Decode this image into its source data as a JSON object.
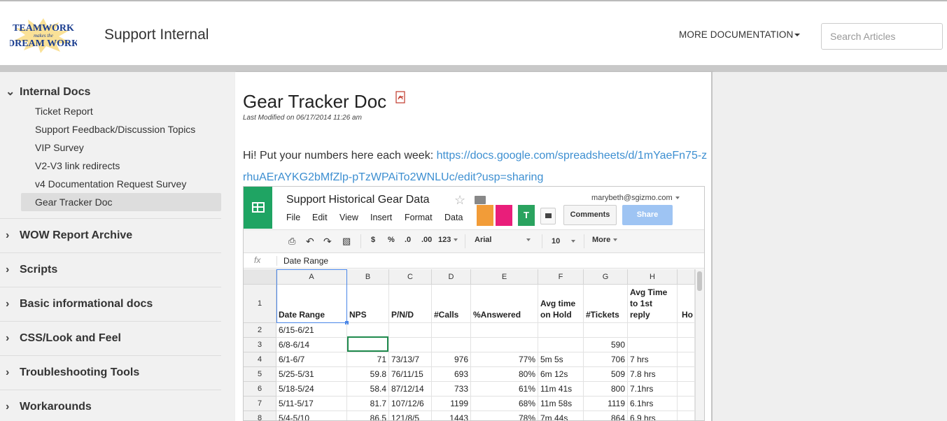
{
  "header": {
    "logo": {
      "line1": "TEAMWORK",
      "line2": "makes the",
      "line3": "DREAM WORK"
    },
    "site_title": "Support Internal",
    "more_docs": "MORE DOCUMENTATION",
    "search_placeholder": "Search Articles"
  },
  "sidebar": {
    "sections": [
      {
        "label": "Internal Docs",
        "expanded": true
      },
      {
        "label": "WOW Report Archive",
        "expanded": false
      },
      {
        "label": "Scripts",
        "expanded": false
      },
      {
        "label": "Basic informational docs",
        "expanded": false
      },
      {
        "label": "CSS/Look and Feel",
        "expanded": false
      },
      {
        "label": "Troubleshooting Tools",
        "expanded": false
      },
      {
        "label": "Workarounds",
        "expanded": false
      }
    ],
    "internal_docs_items": [
      "Ticket Report",
      "Support Feedback/Discussion Topics",
      "VIP Survey",
      "V2-V3 link redirects",
      "v4 Documentation Request Survey",
      "Gear Tracker Doc"
    ],
    "active_item": "Gear Tracker Doc"
  },
  "article": {
    "title": "Gear Tracker Doc",
    "last_modified": "Last Modified on 06/17/2014 11:26 am",
    "intro": "Hi! Put your numbers here each week: ",
    "link": "https://docs.google.com/spreadsheets/d/1mYaeFn75-zrhuAErAYKG2bMfZlp-pTzWPAiTo2WNLUc/edit?usp=sharing"
  },
  "spreadsheet": {
    "title": "Support Historical Gear Data",
    "user_email": "marybeth@sgizmo.com",
    "menus": [
      "File",
      "Edit",
      "View",
      "Insert",
      "Format",
      "Data"
    ],
    "addons": [
      {
        "label": "",
        "color": "#f29c38"
      },
      {
        "label": "",
        "color": "#e91e7a"
      },
      {
        "label": "T",
        "color": "#2aa35f"
      }
    ],
    "comments_label": "Comments",
    "share_label": "Share",
    "toolbar": {
      "currency": "$",
      "percent": "%",
      "dec_decrease": ".0",
      "dec_increase": ".00",
      "number_format": "123",
      "font": "Arial",
      "font_size": "10",
      "more": "More"
    },
    "fx_label": "fx",
    "formula_value": "Date Range",
    "column_letters": [
      "A",
      "B",
      "C",
      "D",
      "E",
      "F",
      "G",
      "H"
    ],
    "header_row": [
      "Date Range",
      "NPS",
      "P/N/D",
      "#Calls",
      "%Answered",
      "Avg time on Hold",
      "#Tickets",
      "Avg Time to 1st reply",
      "Ho"
    ],
    "rows": [
      {
        "n": "2",
        "cells": [
          "6/15-6/21",
          "",
          "",
          "",
          "",
          "",
          "",
          "",
          ""
        ]
      },
      {
        "n": "3",
        "cells": [
          "6/8-6/14",
          "",
          "",
          "",
          "",
          "",
          "590",
          "",
          ""
        ]
      },
      {
        "n": "4",
        "cells": [
          "6/1-6/7",
          "71",
          "73/13/7",
          "976",
          "77%",
          "5m 5s",
          "706",
          "7 hrs",
          ""
        ]
      },
      {
        "n": "5",
        "cells": [
          "5/25-5/31",
          "59.8",
          "76/11/15",
          "693",
          "80%",
          "6m 12s",
          "509",
          "7.8 hrs",
          ""
        ]
      },
      {
        "n": "6",
        "cells": [
          "5/18-5/24",
          "58.4",
          "87/12/14",
          "733",
          "61%",
          "11m 41s",
          "800",
          "7.1hrs",
          ""
        ]
      },
      {
        "n": "7",
        "cells": [
          "5/11-5/17",
          "81.7",
          "107/12/6",
          "1199",
          "68%",
          "11m 58s",
          "1119",
          "6.1hrs",
          ""
        ]
      },
      {
        "n": "8",
        "cells": [
          "5/4-5/10",
          "86.5",
          "121/8/5",
          "1443",
          "78%",
          "7m 44s",
          "864",
          "6.9 hrs",
          ""
        ]
      }
    ]
  }
}
